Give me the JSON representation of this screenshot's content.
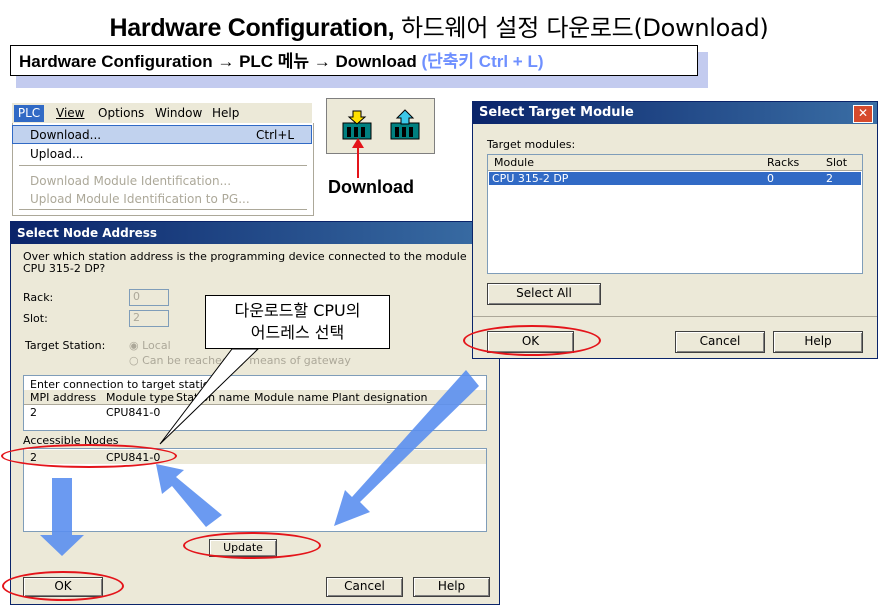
{
  "title": {
    "main": "Hardware Configuration,",
    "korean": "하드웨어 설정 다운로드(Download)"
  },
  "subtitle": {
    "text": "Hardware Configuration → PLC 메뉴 → Download",
    "hint": "(단축키 Ctrl + L)"
  },
  "menubar": {
    "items": [
      "PLC",
      "View",
      "Options",
      "Window",
      "Help"
    ]
  },
  "plc_menu": {
    "download": "Download...",
    "download_shortcut": "Ctrl+L",
    "upload": "Upload...",
    "download_id": "Download Module Identification...",
    "upload_id": "Upload Module Identification to PG..."
  },
  "toolbar": {
    "download_label": "Download"
  },
  "target_dialog": {
    "title": "Select Target Module",
    "list_label": "Target modules:",
    "columns": [
      "Module",
      "Racks",
      "Slot"
    ],
    "rows": [
      {
        "module": "CPU 315-2 DP",
        "racks": "0",
        "slot": "2"
      }
    ],
    "select_all": "Select All",
    "ok": "OK",
    "cancel": "Cancel",
    "help": "Help"
  },
  "node_dialog": {
    "title": "Select Node Address",
    "question": "Over which station address is the programming device connected to the module CPU 315-2 DP?",
    "rack_label": "Rack:",
    "rack_value": "0",
    "slot_label": "Slot:",
    "slot_value": "2",
    "target_station_label": "Target Station:",
    "opt_local": "Local",
    "opt_gateway": "Can be reached by means of gateway",
    "conn_label": "Enter connection to target station:",
    "columns": [
      "MPI address",
      "Module type",
      "Station name",
      "Module name",
      "Plant designation"
    ],
    "conn_row": {
      "mpi": "2",
      "type": "CPU841-0"
    },
    "accessible_label": "Accessible Nodes",
    "acc_row": {
      "mpi": "2",
      "type": "CPU841-0"
    },
    "update": "Update",
    "ok": "OK",
    "cancel": "Cancel",
    "help": "Help"
  },
  "callout": {
    "line1": "다운로드할 CPU의",
    "line2": "어드레스 선택"
  },
  "colors": {
    "highlight": "#316ac5",
    "oval": "#e4141a",
    "arrow": "#5b8ff0",
    "hint": "#6f90ff"
  }
}
